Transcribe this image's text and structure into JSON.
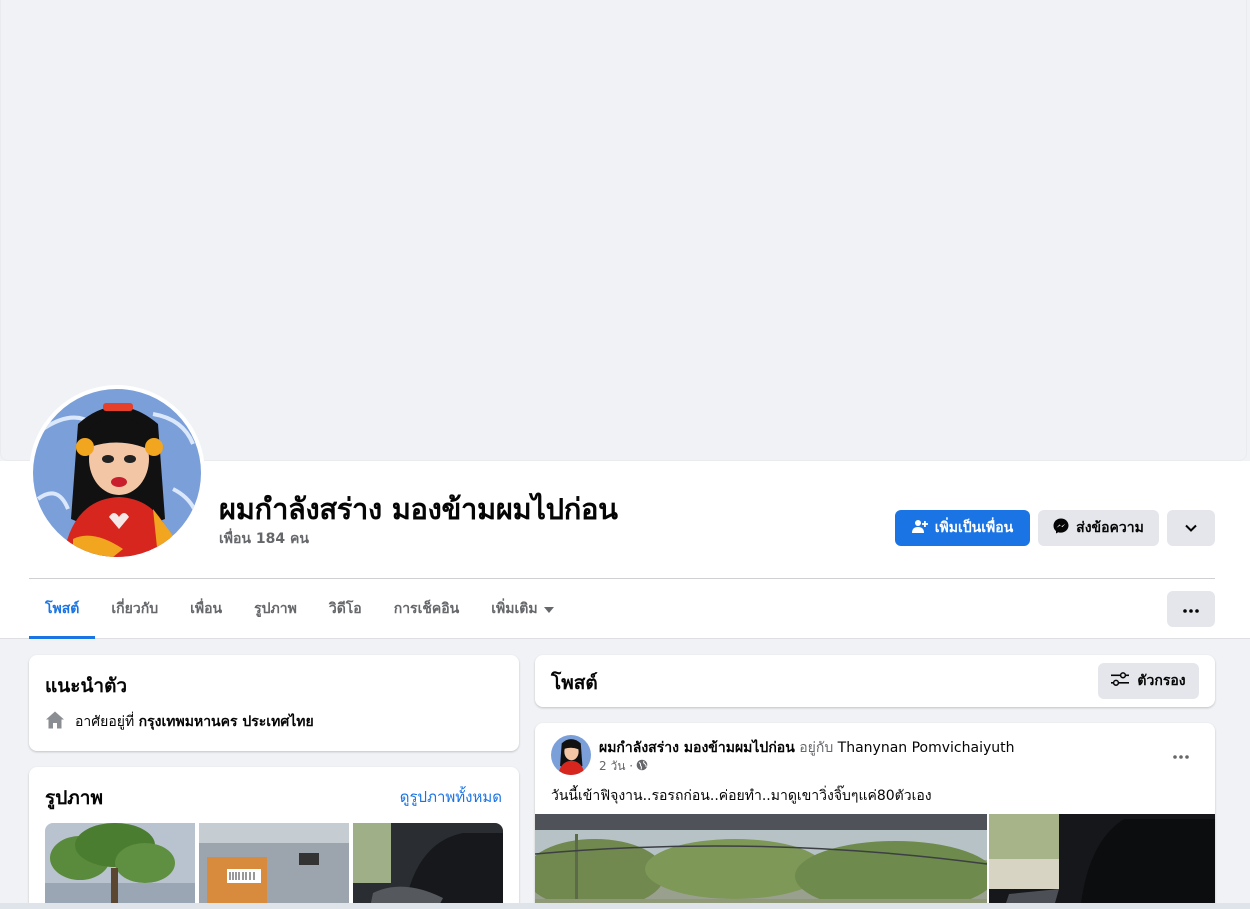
{
  "profile": {
    "name": "ผมกำลังสร่าง มองข้ามผมไปก่อน",
    "friend_count": "เพื่อน 184 คน"
  },
  "actions": {
    "add_friend": "เพิ่มเป็นเพื่อน",
    "message": "ส่งข้อความ"
  },
  "tabs": [
    {
      "label": "โพสต์",
      "active": true
    },
    {
      "label": "เกี่ยวกับ"
    },
    {
      "label": "เพื่อน"
    },
    {
      "label": "รูปภาพ"
    },
    {
      "label": "วิดีโอ"
    },
    {
      "label": "การเช็คอิน"
    },
    {
      "label": "เพิ่มเติม"
    }
  ],
  "intro": {
    "title": "แนะนำตัว",
    "lives_in_prefix": "อาศัยอยู่ที่",
    "lives_in_place": "กรุงเทพมหานคร ประเทศไทย"
  },
  "photos": {
    "title": "รูปภาพ",
    "see_all": "ดูรูปภาพทั้งหมด"
  },
  "posts": {
    "title": "โพสต์",
    "filter_label": "ตัวกรอง"
  },
  "post": {
    "author": "ผมกำลังสร่าง มองข้ามผมไปก่อน",
    "with_text": "อยู่กับ",
    "tagged": "Thanynan Pomvichaiyuth",
    "time": "2 วัน ·",
    "text": "วันนี้เข้าฟิจุงาน..รอรถก่อน..ค่อยทำ..มาดูเขาวิ่งจิ๊บๆแค่80ตัวเอง"
  },
  "colors": {
    "accent": "#1b74e4",
    "page_bg": "#f0f2f5",
    "secondary_button": "#e4e6eb"
  },
  "icons": {
    "add_friend": "person-plus-icon",
    "message": "messenger-icon",
    "dropdown": "chevron-down-icon",
    "more": "ellipsis-icon",
    "home": "house-icon",
    "filter": "sliders-icon",
    "audience": "globe-icon"
  }
}
